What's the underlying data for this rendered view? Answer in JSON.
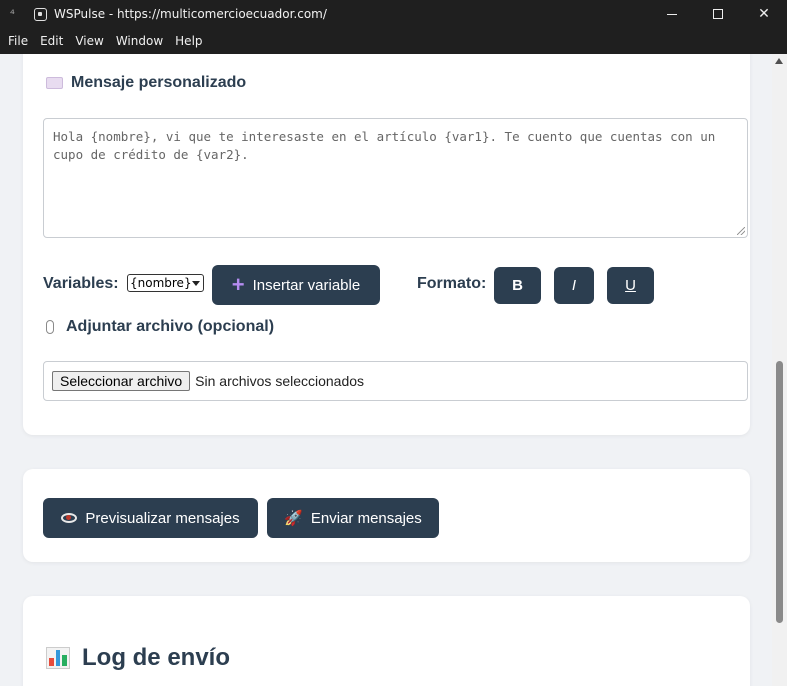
{
  "window": {
    "title": "WSPulse - https://multicomercioecuador.com/"
  },
  "menu": [
    "File",
    "Edit",
    "View",
    "Window",
    "Help"
  ],
  "message": {
    "section_title": "Mensaje personalizado",
    "text_line1": "Hola {nombre}, vi que te interesaste en el artículo {var1}. Te cuento que cuentas con un",
    "text_line2": "cupo de crédito de {var2}.",
    "variables_label": "Variables:",
    "variable_selected": "{nombre}",
    "insert_button": "Insertar variable",
    "format_label": "Formato:",
    "bold": "B",
    "italic": "I",
    "underline": "U"
  },
  "attachment": {
    "section_title": "Adjuntar archivo (opcional)",
    "choose_button": "Seleccionar archivo",
    "status": "Sin archivos seleccionados"
  },
  "actions": {
    "preview": "Previsualizar mensajes",
    "send": "Enviar mensajes"
  },
  "log": {
    "title": "Log de envío"
  },
  "colors": {
    "primary_button": "#2c3e50",
    "heading": "#2c3e50",
    "background": "#f0f2f5"
  }
}
